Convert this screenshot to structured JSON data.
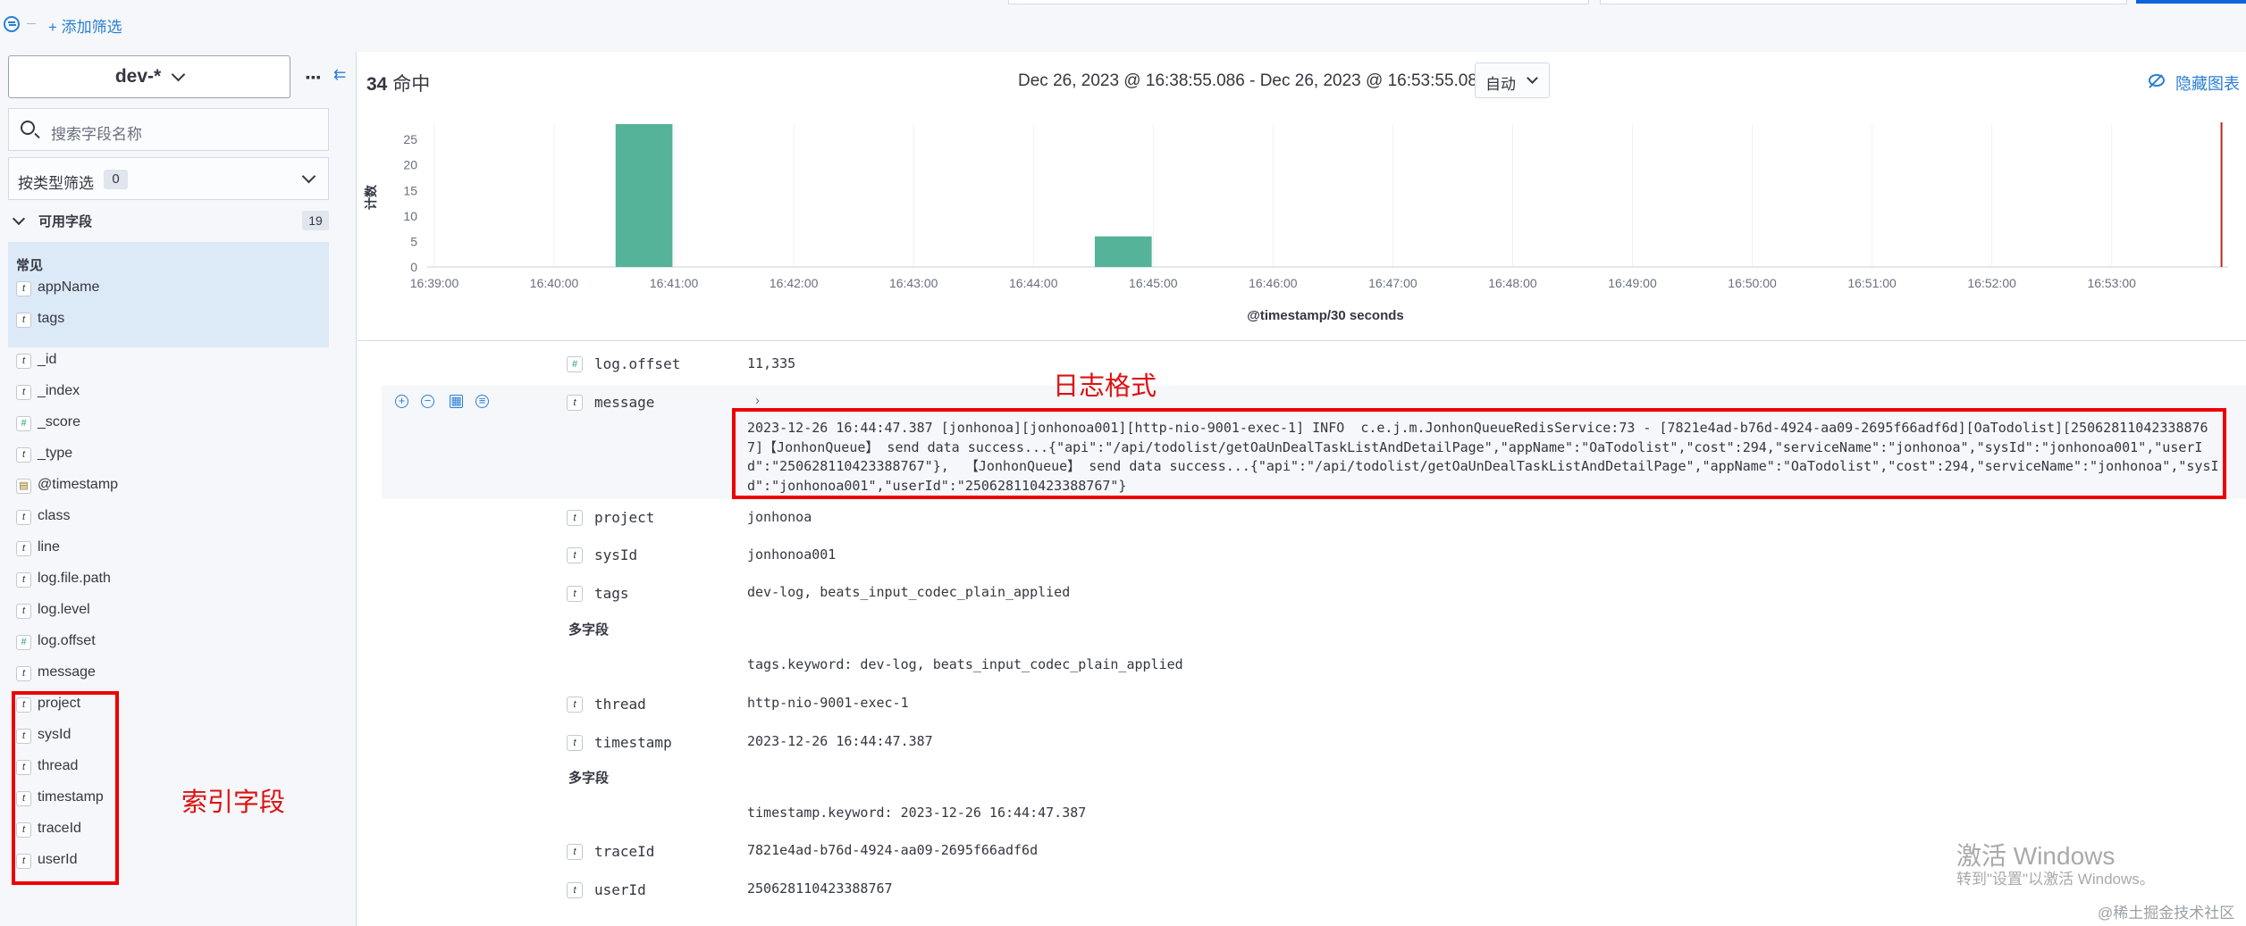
{
  "topbar": {
    "add_filter": "+ 添加筛选"
  },
  "sidebar": {
    "index_pattern": "dev-*",
    "search_placeholder": "搜索字段名称",
    "type_filter_label": "按类型筛选",
    "type_filter_count": "0",
    "available_label": "可用字段",
    "available_count": "19",
    "common_label": "常见",
    "common_fields": [
      {
        "type": "t",
        "name": "appName"
      },
      {
        "type": "t",
        "name": "tags"
      }
    ],
    "fields": [
      {
        "type": "t",
        "name": "_id"
      },
      {
        "type": "t",
        "name": "_index"
      },
      {
        "type": "#",
        "name": "_score"
      },
      {
        "type": "t",
        "name": "_type"
      },
      {
        "type": "date",
        "name": "@timestamp"
      },
      {
        "type": "t",
        "name": "class"
      },
      {
        "type": "t",
        "name": "line"
      },
      {
        "type": "t",
        "name": "log.file.path"
      },
      {
        "type": "t",
        "name": "log.level"
      },
      {
        "type": "#",
        "name": "log.offset"
      },
      {
        "type": "t",
        "name": "message"
      },
      {
        "type": "t",
        "name": "project"
      },
      {
        "type": "t",
        "name": "sysId"
      },
      {
        "type": "t",
        "name": "thread"
      },
      {
        "type": "t",
        "name": "timestamp"
      },
      {
        "type": "t",
        "name": "traceId"
      },
      {
        "type": "t",
        "name": "userId"
      }
    ]
  },
  "annotations": {
    "index_fields": "索引字段",
    "log_format": "日志格式"
  },
  "header": {
    "hits_count": "34",
    "hits_label": "命中",
    "time_range": "Dec 26, 2023 @ 16:38:55.086 - Dec 26, 2023 @ 16:53:55.086",
    "interval": "自动",
    "hide_chart": "隐藏图表"
  },
  "chart_data": {
    "type": "bar",
    "xlabel": "@timestamp/30 seconds",
    "ylabel": "计数",
    "ylim": [
      0,
      28
    ],
    "y_ticks": [
      0,
      5,
      10,
      15,
      20,
      25
    ],
    "x_ticks": [
      "16:39:00",
      "16:40:00",
      "16:41:00",
      "16:42:00",
      "16:43:00",
      "16:44:00",
      "16:45:00",
      "16:46:00",
      "16:47:00",
      "16:48:00",
      "16:49:00",
      "16:50:00",
      "16:51:00",
      "16:52:00",
      "16:53:00"
    ],
    "x_range_minutes": [
      0,
      15.8
    ],
    "bars": [
      {
        "start": "16:40:30",
        "value": 28
      },
      {
        "start": "16:44:30",
        "value": 6
      }
    ],
    "bar_color": "#54b399",
    "current_time_marker": "16:53:55"
  },
  "document": {
    "log_offset": {
      "name": "log.offset",
      "value": "11,335"
    },
    "message": {
      "name": "message",
      "value": "2023-12-26 16:44:47.387 [jonhonoa][jonhonoa001][http-nio-9001-exec-1] INFO  c.e.j.m.JonhonQueueRedisService:73 - [7821e4ad-b76d-4924-aa09-2695f66adf6d][OaTodolist][250628110423388767]【JonhonQueue】 send data success...{\"api\":\"/api/todolist/getOaUnDealTaskListAndDetailPage\",\"appName\":\"OaTodolist\",\"cost\":294,\"serviceName\":\"jonhonoa\",\"sysId\":\"jonhonoa001\",\"userId\":\"250628110423388767\"},  【JonhonQueue】 send data success...{\"api\":\"/api/todolist/getOaUnDealTaskListAndDetailPage\",\"appName\":\"OaTodolist\",\"cost\":294,\"serviceName\":\"jonhonoa\",\"sysId\":\"jonhonoa001\",\"userId\":\"250628110423388767\"}"
    },
    "project": {
      "name": "project",
      "value": "jonhonoa"
    },
    "sysId": {
      "name": "sysId",
      "value": "jonhonoa001"
    },
    "tags": {
      "name": "tags",
      "value": "dev-log, beats_input_codec_plain_applied"
    },
    "multi_field_label": "多字段",
    "tags_keyword": "tags.keyword: dev-log, beats_input_codec_plain_applied",
    "thread": {
      "name": "thread",
      "value": "http-nio-9001-exec-1"
    },
    "timestamp": {
      "name": "timestamp",
      "value": "2023-12-26 16:44:47.387"
    },
    "timestamp_keyword": "timestamp.keyword: 2023-12-26 16:44:47.387",
    "traceId": {
      "name": "traceId",
      "value": "7821e4ad-b76d-4924-aa09-2695f66adf6d"
    },
    "userId": {
      "name": "userId",
      "value": "250628110423388767"
    }
  },
  "watermark": {
    "line1": "激活 Windows",
    "line2": "转到\"设置\"以激活 Windows。"
  },
  "credit": "@稀土掘金技术社区"
}
